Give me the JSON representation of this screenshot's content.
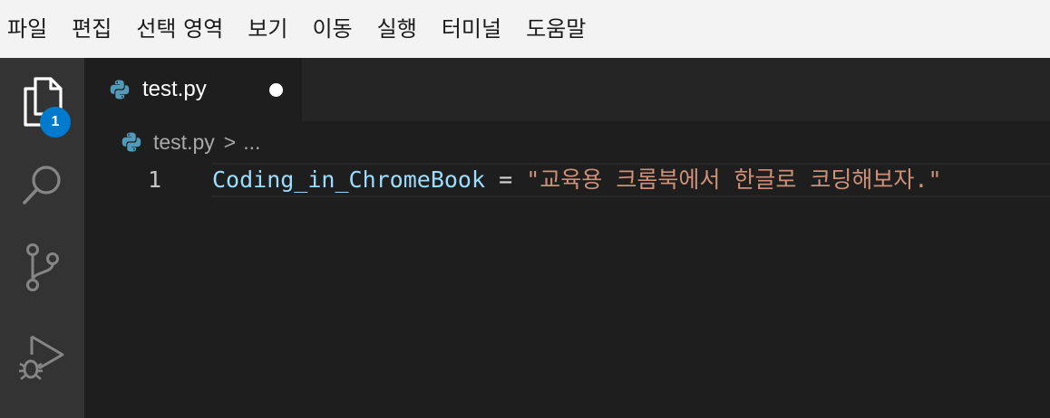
{
  "menubar": {
    "items": [
      "파일",
      "편집",
      "선택 영역",
      "보기",
      "이동",
      "실행",
      "터미널",
      "도움말"
    ]
  },
  "activitybar": {
    "items": [
      {
        "name": "explorer",
        "icon": "files-icon",
        "badge": "1"
      },
      {
        "name": "search",
        "icon": "search-icon"
      },
      {
        "name": "source-control",
        "icon": "source-control-icon"
      },
      {
        "name": "run-debug",
        "icon": "run-debug-icon"
      }
    ],
    "active_color": "#ffffff",
    "inactive_color": "#858585"
  },
  "tab": {
    "title": "test.py",
    "icon": "python-icon",
    "modified": true
  },
  "breadcrumb": {
    "file": "test.py",
    "separator": ">",
    "rest": "..."
  },
  "editor": {
    "lines": [
      {
        "number": "1",
        "variable": "Coding_in_ChromeBook",
        "operator": "=",
        "string": "\"교육용 크롬북에서 한글로 코딩해보자.\""
      }
    ]
  },
  "colors": {
    "menubar_bg": "#f3f3f3",
    "activitybar_bg": "#333333",
    "editor_bg": "#1e1e1e",
    "tabbar_bg": "#252526",
    "badge_bg": "#007acc",
    "variable": "#9cdcfe",
    "string": "#ce9178",
    "python_blue": "#519aba"
  }
}
